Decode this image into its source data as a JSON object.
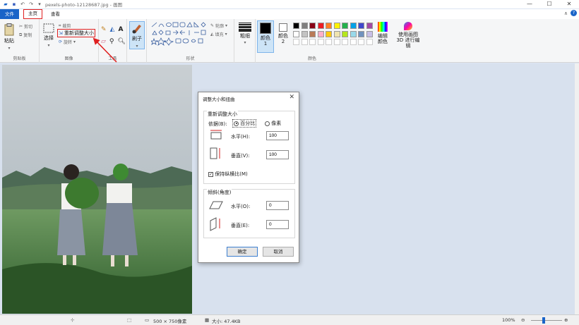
{
  "window": {
    "title": "pexels-photo-12128687.jpg - 画图",
    "qat": [
      "save-icon",
      "undo-icon",
      "redo-icon",
      "dropdown-icon"
    ]
  },
  "tabs": [
    "文件",
    "主页",
    "查看"
  ],
  "ribbon": {
    "clipboard": {
      "paste": "粘贴",
      "cut": "剪切",
      "copy": "复制",
      "label": "剪贴板"
    },
    "image": {
      "select": "选择",
      "crop": "裁剪",
      "resize": "重新调整大小",
      "rotate": "旋转",
      "label": "图像"
    },
    "tools": {
      "label": "工具"
    },
    "brushes": {
      "label": "刷子"
    },
    "shapes": {
      "outline": "轮廓",
      "fill": "填充",
      "label": "形状"
    },
    "size": {
      "label": "粗细"
    },
    "colors": {
      "color1": "颜色 1",
      "color2": "颜色 2",
      "edit": "编辑颜色",
      "paint3d": "使用画图 3D 进行编辑",
      "label": "颜色",
      "palette": [
        "#000000",
        "#7f7f7f",
        "#880015",
        "#ed1c24",
        "#ff7f27",
        "#fff200",
        "#22b14c",
        "#00a2e8",
        "#3f48cc",
        "#a349a4",
        "#ffffff",
        "#c3c3c3",
        "#b97a57",
        "#ffaec9",
        "#ffc90e",
        "#efe4b0",
        "#b5e61d",
        "#99d9ea",
        "#7092be",
        "#c8bfe7"
      ]
    }
  },
  "dialog": {
    "title": "调整大小和扭曲",
    "resize_group": "重新调整大小",
    "by_label": "依据(B):",
    "percent": "百分比",
    "pixels": "像素",
    "horizontal": "水平(H):",
    "vertical": "垂直(V):",
    "h_value": "100",
    "v_value": "100",
    "keep_ratio": "保持纵横比(M)",
    "skew_group": "倾斜(角度)",
    "skew_h": "水平(O):",
    "skew_v": "垂直(E):",
    "skew_h_value": "0",
    "skew_v_value": "0",
    "ok": "确定",
    "cancel": "取消"
  },
  "status": {
    "dimensions": "500 × 750像素",
    "size": "大小: 47.4KB",
    "zoom": "100%"
  },
  "colors": {
    "accent": "#1a64c8",
    "highlight": "#e02020"
  }
}
